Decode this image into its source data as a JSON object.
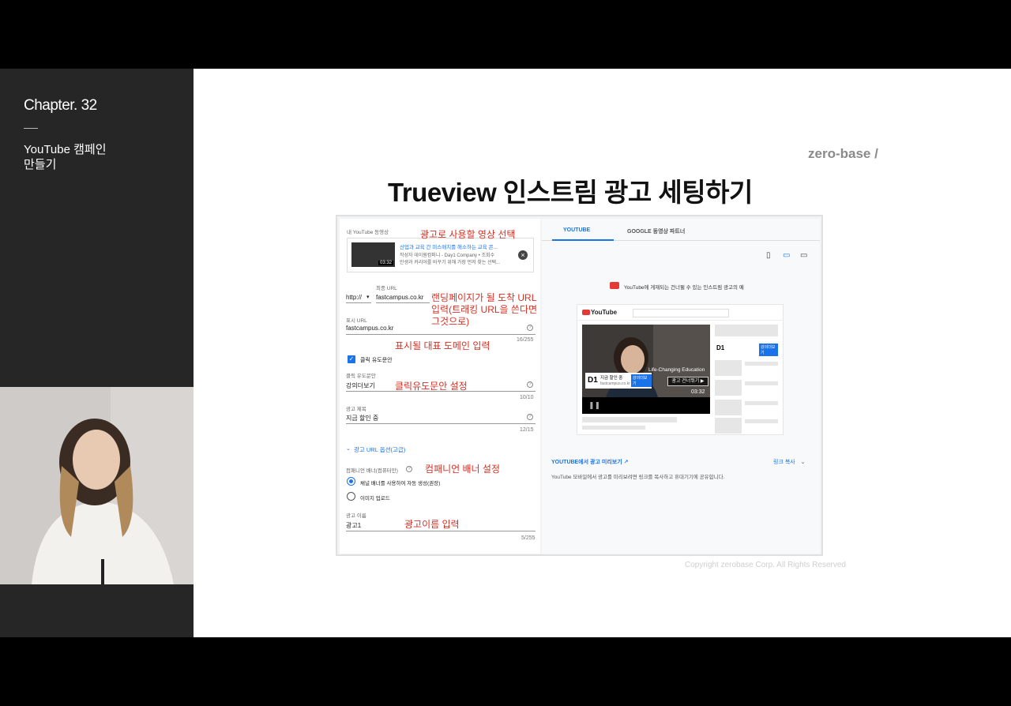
{
  "sidebar": {
    "chapter": "Chapter. 32",
    "topic_line1": "YouTube 캠페인",
    "topic_line2": "만들기"
  },
  "slide": {
    "brand": "zero-base /",
    "title": "Trueview 인스트림 광고 세팅하기",
    "copyright": "Copyright zerobase Corp. All Rights Reserved"
  },
  "form": {
    "my_video_label": "내 YouTube 동영상",
    "video": {
      "title": "산업과 교육 간 미스매치를 해소하는 교육 콘...",
      "meta": "작성자 데이원컴퍼니 - Day1 Company • 조회수",
      "meta2": "인생과 커리어를 바꾸기 위해 가장 먼저 찾는 선택...",
      "duration": "03:32"
    },
    "final_url_label": "최종 URL",
    "protocol": "http://",
    "final_url_value": "fastcampus.co.kr",
    "display_url_label": "표시 URL",
    "display_url_value": "fastcampus.co.kr",
    "display_url_count": "16/255",
    "cta_checkbox_label": "클릭 유도문안",
    "cta_label": "클릭 유도문안",
    "cta_value": "강의더보기",
    "cta_count": "10/10",
    "headline_label": "광고 제목",
    "headline_value": "지금 할인 중",
    "headline_count": "12/15",
    "url_options": "광고 URL 옵션(고급)",
    "companion_label": "컴패니언 배너(컴퓨터만)",
    "radio_auto": "채널 배너를 사용하여 자동 생성(권장)",
    "radio_upload": "이미지 업로드",
    "ad_name_label": "광고 이름",
    "ad_name_value": "광고1",
    "ad_name_count": "5/255"
  },
  "annotations": {
    "select_video": "광고로 사용할 영상 선택",
    "landing_1": "랜딩페이지가 될 도착 URL",
    "landing_2": "입력(트래킹 URL을 쓴다면",
    "landing_3": "그것으로)",
    "display_domain": "표시될 대표 도메인 입력",
    "cta_setting": "클릭유도문안 설정",
    "companion_setting": "컴패니언 배너 설정",
    "ad_name_input": "광고이름 입력"
  },
  "preview": {
    "tab_youtube": "YOUTUBE",
    "tab_google": "GOOGLE 동영상 파트너",
    "notice": "YouTube에 게재되는 건너뛸 수 있는 인스트림 광고의 예",
    "yt_logo": "YouTube",
    "ad_rank": "D1",
    "ad_headline": "지금 할인 중",
    "ad_cta": "강의더보기",
    "ad_url": "fastcampus.co.kr",
    "caption": "Life-Changing Education",
    "skip": "광고 건너뛰기 ▶",
    "duration": "03:32",
    "side_rank": "D1",
    "side_cta": "강의더보기",
    "preview_link": "YOUTUBE에서 광고 미리보기",
    "copy_link": "링크 복사",
    "description": "YouTube 모바일에서 광고를 미리보려면 링크를 복사하고 휴대기기에 공유합니다."
  },
  "colors": {
    "annotation": "#d93025",
    "accent": "#1a73e8",
    "sidebar_bg": "#262626"
  }
}
